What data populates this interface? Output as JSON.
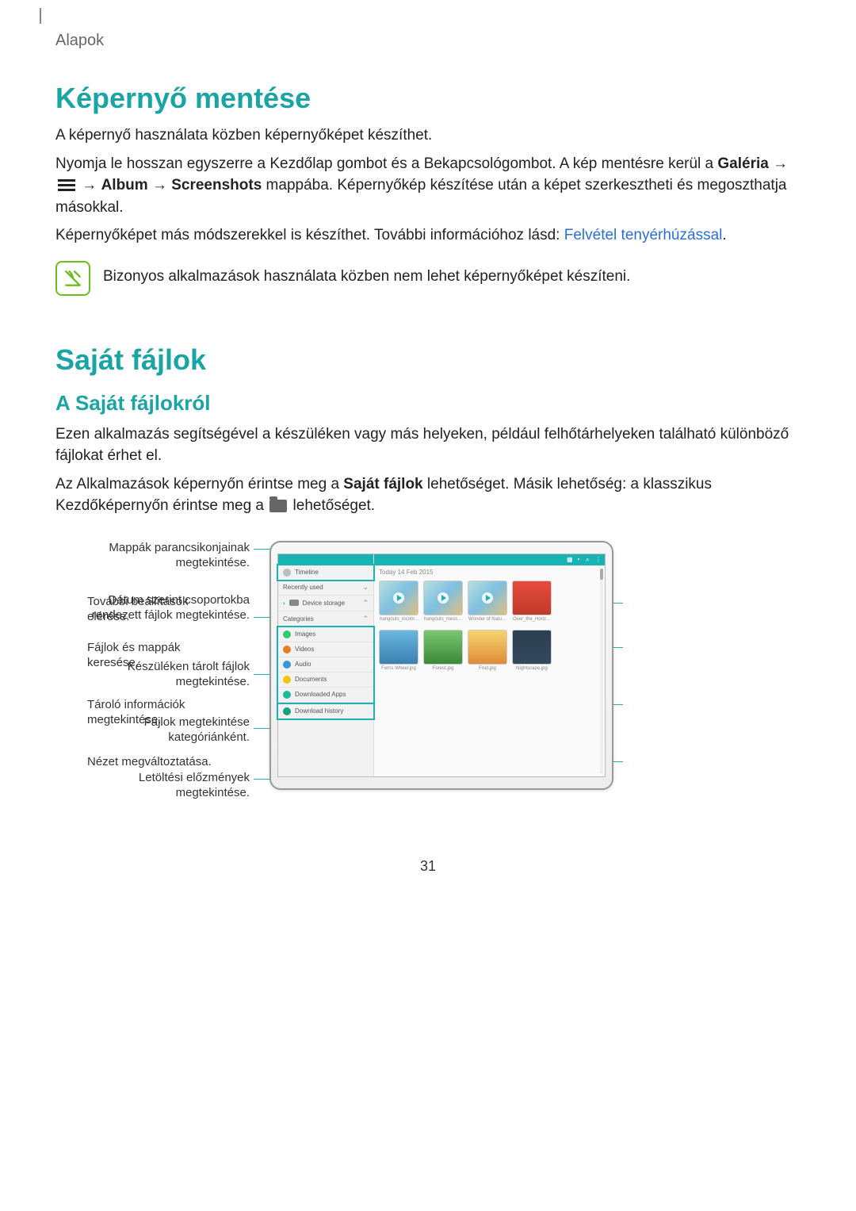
{
  "header": {
    "section": "Alapok"
  },
  "h1_screenshot": "Képernyő mentése",
  "p_screenshot_intro": "A képernyő használata közben képernyőképet készíthet.",
  "p_screenshot_2a": "Nyomja le hosszan egyszerre a Kezdőlap gombot és a Bekapcsológombot. A kép mentésre kerül a ",
  "bold_galeria": "Galéria",
  "arrow": " → ",
  "bold_album": "Album",
  "bold_screenshots": "Screenshots",
  "p_screenshot_2b": " mappába. Képernyőkép készítése után a képet szerkesztheti és megoszthatja másokkal.",
  "p_screenshot_3a": "Képernyőképet más módszerekkel is készíthet. További információhoz lásd: ",
  "link_palm": "Felvétel tenyérhúzással",
  "period": ".",
  "note_text": "Bizonyos alkalmazások használata közben nem lehet képernyőképet készíteni.",
  "h1_myfiles": "Saját fájlok",
  "h2_about": "A Saját fájlokról",
  "p_myfiles_1": "Ezen alkalmazás segítségével a készüléken vagy más helyeken, például felhőtárhelyeken található különböző fájlokat érhet el.",
  "p_myfiles_2a": "Az Alkalmazások képernyőn érintse meg a ",
  "bold_sajat": "Saját fájlok",
  "p_myfiles_2b": " lehetőséget. Másik lehetőség: a klasszikus Kezdőképernyőn érintse meg a ",
  "p_myfiles_2c": " lehetőséget.",
  "callouts": {
    "left1": "Mappák parancsikonjainak megtekintése.",
    "left2": "Dátum szerint csoportokba rendezett fájlok megtekintése.",
    "left3": "Készüléken tárolt fájlok megtekintése.",
    "left4": "Fájlok megtekintése kategóriánként.",
    "left5": "Letöltési előzmények megtekintése.",
    "right1": "További beállítások elérése.",
    "right2": "Fájlok és mappák keresése.",
    "right3": "Tároló információk megtekintése.",
    "right4": "Nézet megváltoztatása."
  },
  "sidebar_items": {
    "timeline": "Timeline",
    "recent": "Recently used",
    "device": "Device storage",
    "categories": "Categories",
    "images": "Images",
    "videos": "Videos",
    "audio": "Audio",
    "documents": "Documents",
    "apps": "Downloaded Apps",
    "download": "Download history"
  },
  "main_title": "Today   14 Feb 2015",
  "thumbs": [
    "hangouts_incom…",
    "hangouts_mess…",
    "Wonder of Natu…",
    "Over_the_Horiz…"
  ],
  "row2labels": [
    "Ferris Wheel.jpg",
    "Forest.jpg",
    "Fruit.jpg",
    "Nightscape.jpg"
  ],
  "page_number": "31"
}
